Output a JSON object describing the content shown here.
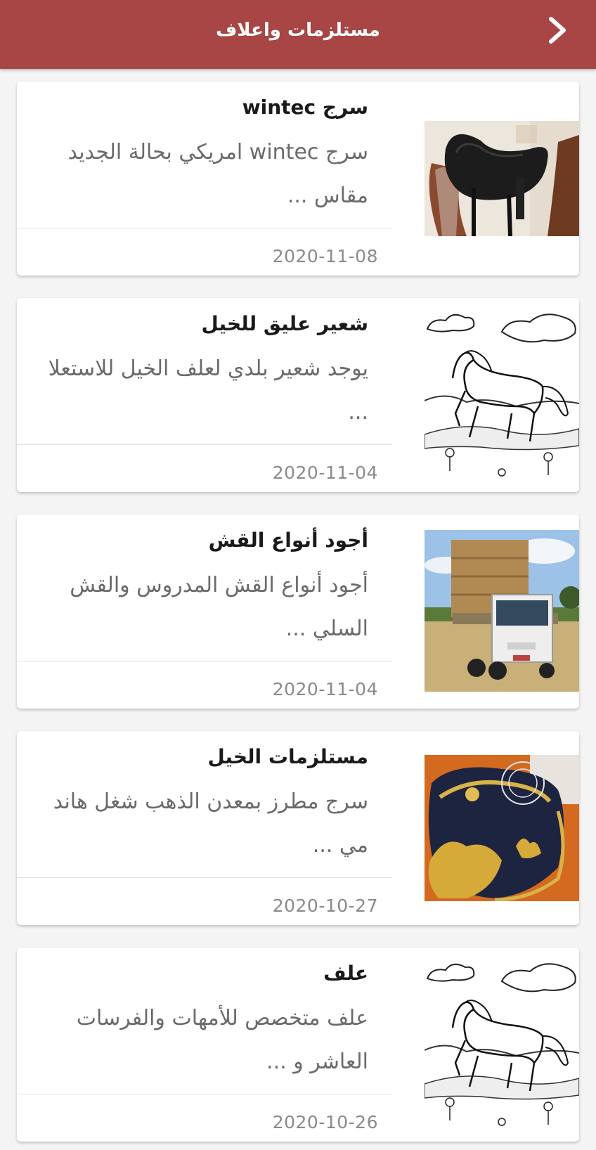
{
  "header": {
    "title": "مستلزمات واعلاف",
    "back_icon": "chevron-right-icon",
    "background": "#a84545"
  },
  "items": [
    {
      "title": "سرج wintec",
      "description": "سرج wintec امريكي بحالة الجديد مقاس ...",
      "date": "2020-11-08",
      "image": "saddle-photo"
    },
    {
      "title": "شعير عليق للخيل",
      "description": "يوجد شعير بلدي لعلف الخيل للاستعلا ...",
      "date": "2020-11-04",
      "image": "horse-sketch"
    },
    {
      "title": "أجود أنواع القش",
      "description": "أجود أنواع القش المدروس والقش السلي ...",
      "date": "2020-11-04",
      "image": "hay-truck-photo"
    },
    {
      "title": "مستلزمات الخيل",
      "description": "سرج مطرز بمعدن الذهب شغل هاند مي ...",
      "date": "2020-10-27",
      "image": "gold-saddle-photo"
    },
    {
      "title": "علف",
      "description": "علف متخصص للأمهات والفرسات العاشر و ...",
      "date": "2020-10-26",
      "image": "horse-sketch"
    }
  ]
}
